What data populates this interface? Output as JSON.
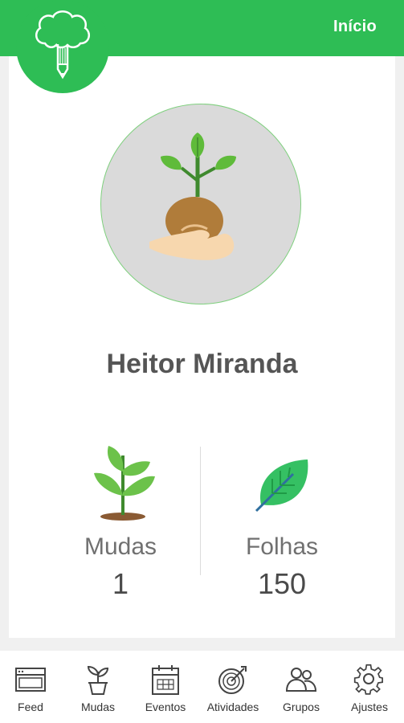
{
  "header": {
    "title": "Início",
    "logo_icon": "tree-pencil-icon",
    "brand_color": "#2ebd55"
  },
  "profile": {
    "avatar_icon": "plant-in-hand-icon",
    "name": "Heitor Miranda"
  },
  "stats": [
    {
      "label": "Mudas",
      "value": "1",
      "icon": "seedling-icon"
    },
    {
      "label": "Folhas",
      "value": "150",
      "icon": "leaf-icon"
    }
  ],
  "nav": {
    "items": [
      {
        "label": "Feed",
        "icon": "feed-icon"
      },
      {
        "label": "Mudas",
        "icon": "potted-plant-icon"
      },
      {
        "label": "Eventos",
        "icon": "calendar-icon"
      },
      {
        "label": "Atividades",
        "icon": "target-icon"
      },
      {
        "label": "Grupos",
        "icon": "group-icon"
      },
      {
        "label": "Ajustes",
        "icon": "gear-icon"
      }
    ]
  }
}
